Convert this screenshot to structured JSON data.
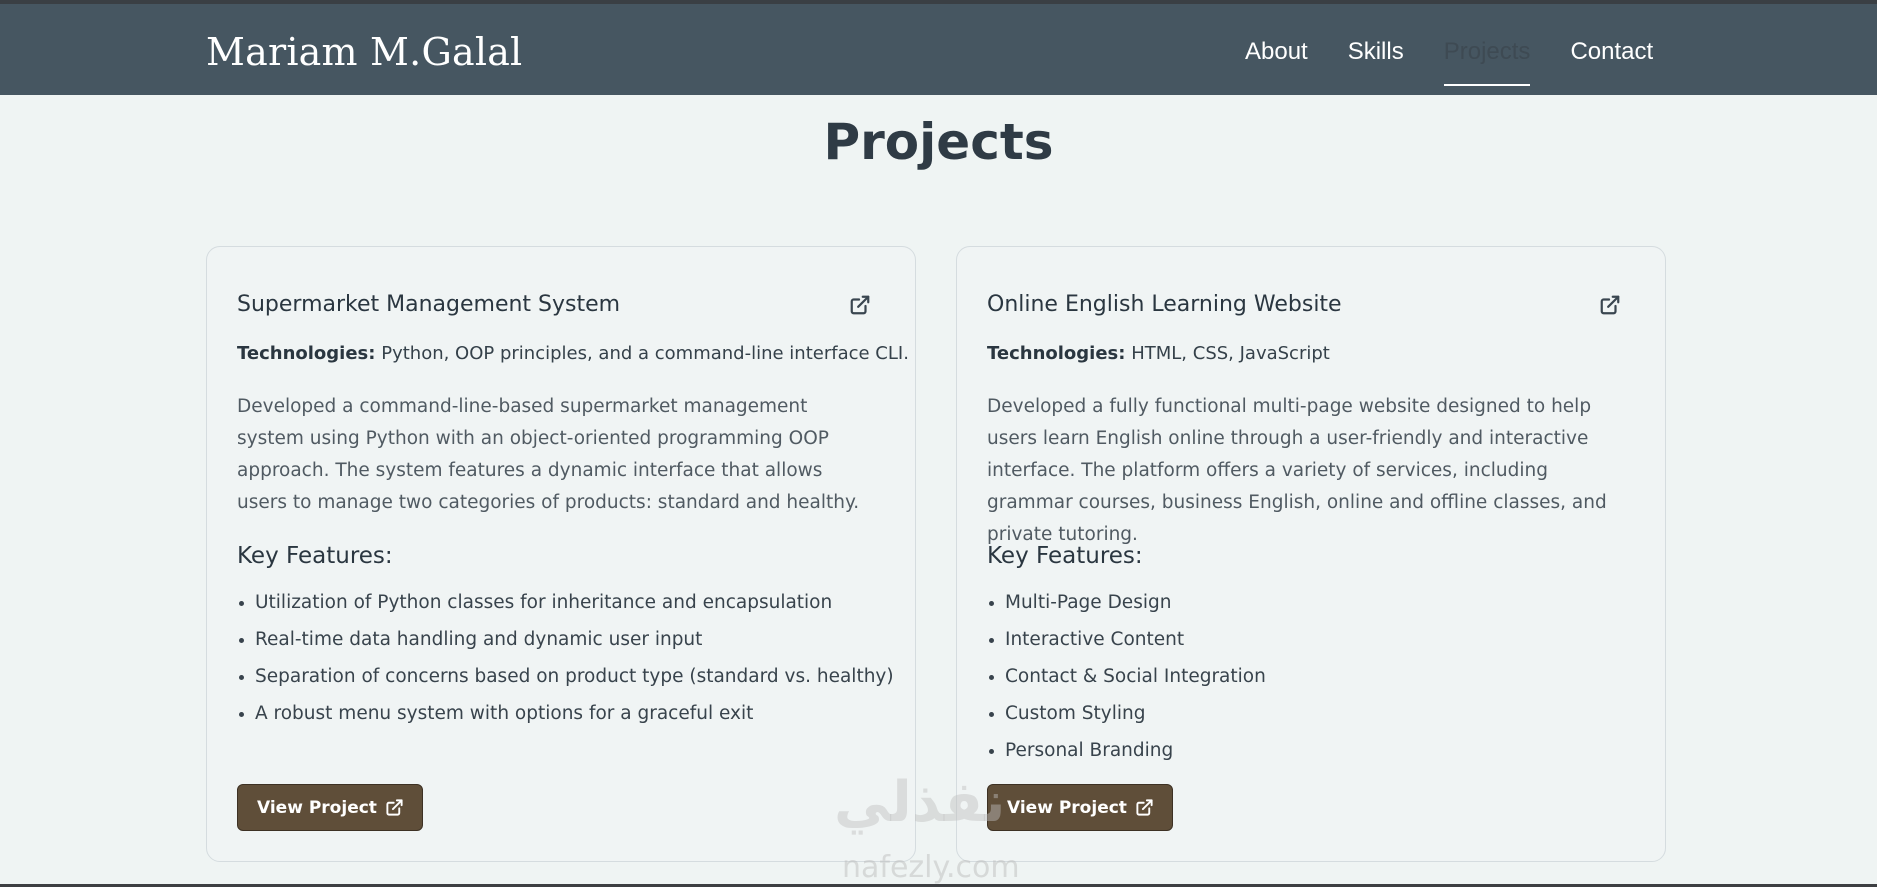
{
  "header": {
    "brand": "Mariam M.Galal",
    "nav": [
      {
        "label": "About"
      },
      {
        "label": "Skills"
      },
      {
        "label": "Projects"
      },
      {
        "label": "Contact"
      }
    ],
    "active": "Projects"
  },
  "page": {
    "title": "Projects"
  },
  "projects": [
    {
      "title": "Supermarket Management System",
      "tech_label": "Technologies:",
      "tech_value": "Python, OOP principles, and a command-line interface CLI.",
      "description": "Developed a command-line-based supermarket management system using Python with an object-oriented programming OOP approach. The system features a dynamic interface that allows users to manage two categories of products: standard and healthy.",
      "features_title": "Key Features:",
      "features": [
        "Utilization of Python classes for inheritance and encapsulation",
        "Real-time data handling and dynamic user input",
        "Separation of concerns based on product type (standard vs. healthy)",
        "A robust menu system with options for a graceful exit"
      ],
      "button_label": "View Project"
    },
    {
      "title": "Online English Learning Website",
      "tech_label": "Technologies:",
      "tech_value": "HTML, CSS, JavaScript",
      "description": "Developed a fully functional multi-page website designed to help users learn English online through a user-friendly and interactive interface. The platform offers a variety of services, including grammar courses, business English, online and offline classes, and private tutoring.",
      "features_title": "Key Features:",
      "features": [
        "Multi-Page Design",
        "Interactive Content",
        "Contact & Social Integration",
        "Custom Styling",
        "Personal Branding"
      ],
      "button_label": "View Project"
    }
  ],
  "watermark": {
    "arabic": "نفذلي",
    "latin": "nafezly.com"
  },
  "colors": {
    "header_bg": "#465661",
    "page_bg": "#eff4f3",
    "button_bg": "#5f4e39"
  }
}
